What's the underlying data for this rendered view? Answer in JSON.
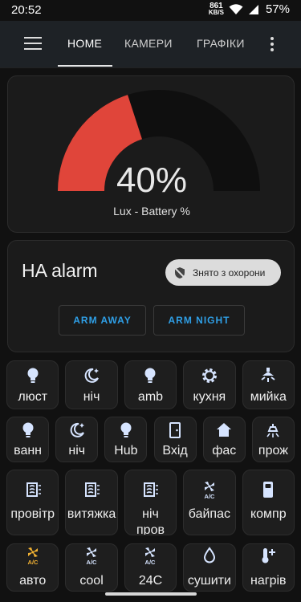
{
  "status_bar": {
    "time": "20:52",
    "net_speed_value": "861",
    "net_speed_unit": "KB/S",
    "battery": "57%"
  },
  "app_bar": {
    "tabs": [
      {
        "label": "HOME",
        "active": true
      },
      {
        "label": "КАМЕРИ",
        "active": false
      },
      {
        "label": "ГРАФІКИ",
        "active": false
      }
    ]
  },
  "gauge": {
    "value": "40%",
    "fraction": 0.4,
    "label": "Lux - Battery %",
    "fill_color": "#e0453a",
    "track_color": "#0f0f0f"
  },
  "alarm": {
    "title": "HA alarm",
    "state": "Знято з охорони",
    "arm_away": "ARM AWAY",
    "arm_night": "ARM NIGHT",
    "accent": "#2f9fe6"
  },
  "tiles_row1": [
    {
      "label": "люст",
      "icon": "bulb-icon"
    },
    {
      "label": "ніч",
      "icon": "moon-stars-icon"
    },
    {
      "label": "amb",
      "icon": "bulb-icon"
    },
    {
      "label": "кухня",
      "icon": "gear-icon"
    },
    {
      "label": "мийка",
      "icon": "ceiling-light-icon"
    }
  ],
  "tiles_row2": [
    {
      "label": "ванн",
      "icon": "bulb-icon"
    },
    {
      "label": "ніч",
      "icon": "moon-stars-icon"
    },
    {
      "label": "Hub",
      "icon": "bulb-icon"
    },
    {
      "label": "Вхід",
      "icon": "door-icon"
    },
    {
      "label": "фас",
      "icon": "home-icon"
    },
    {
      "label": "прож",
      "icon": "spotlight-icon"
    }
  ],
  "tiles_row3": [
    {
      "label": "провітр",
      "icon": "air-filter-icon"
    },
    {
      "label": "витяжка",
      "icon": "air-filter-icon"
    },
    {
      "label": "ніч",
      "label2": "пров",
      "icon": "air-filter-icon"
    },
    {
      "label": "байпас",
      "icon": "ac-fan-icon"
    },
    {
      "label": "компр",
      "icon": "compressor-icon"
    }
  ],
  "tiles_row4": [
    {
      "label": "авто",
      "icon": "ac-fan-icon",
      "color": "#f2b233"
    },
    {
      "label": "cool",
      "icon": "ac-fan-icon"
    },
    {
      "label": "24C",
      "icon": "ac-fan-icon"
    },
    {
      "label": "сушити",
      "icon": "water-drop-icon"
    },
    {
      "label": "нагрів",
      "icon": "thermometer-plus-icon"
    }
  ]
}
